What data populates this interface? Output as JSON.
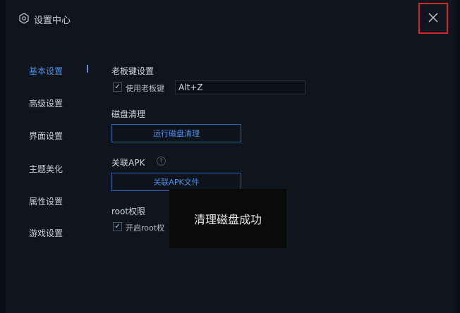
{
  "window": {
    "title": "设置中心",
    "icons": {
      "title": "gear-icon",
      "close": "close-icon"
    }
  },
  "nav": {
    "items": [
      {
        "label": "基本设置",
        "active": true
      },
      {
        "label": "高级设置",
        "active": false
      },
      {
        "label": "界面设置",
        "active": false
      },
      {
        "label": "主题美化",
        "active": false
      },
      {
        "label": "属性设置",
        "active": false
      },
      {
        "label": "游戏设置",
        "active": false
      }
    ]
  },
  "boss_key": {
    "title": "老板键设置",
    "checkbox_label": "使用老板键",
    "checked": true,
    "value": "Alt+Z"
  },
  "disk_clean": {
    "title": "磁盘清理",
    "button_label": "运行磁盘清理"
  },
  "apk": {
    "title": "关联APK",
    "help_icon": "question-icon",
    "button_label": "关联APK文件"
  },
  "root": {
    "title": "root权限",
    "checkbox_label": "开启root权",
    "checked": true
  },
  "toast": {
    "message": "清理磁盘成功"
  },
  "colors": {
    "accent": "#4f8fe6",
    "background": "#10141c",
    "highlight_border": "#d4262c"
  }
}
